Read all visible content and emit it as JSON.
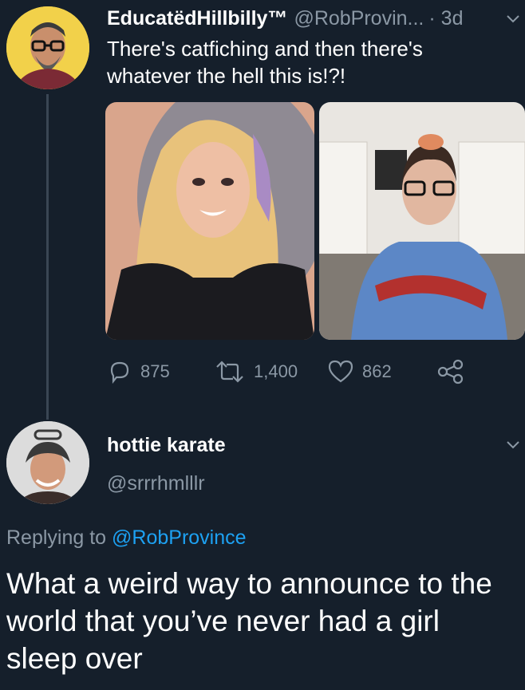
{
  "tweet1": {
    "display_name": "EducatëdHillbilly™",
    "handle": "@RobProvin...",
    "time": "· 3d",
    "text_line1": "There's catfiching and then there's",
    "text_line2": "whatever the hell this is!?!",
    "actions": {
      "replies": "875",
      "retweets": "1,400",
      "likes": "862"
    }
  },
  "reply": {
    "display_name": "hottie karate",
    "handle": "@srrrhmlllr",
    "replying_prefix": "Replying to ",
    "replying_to": "@RobProvince",
    "text": "What a weird way to announce to the world that you’ve never had a girl sleep over"
  },
  "colors": {
    "background": "#151f2b",
    "muted": "#8b98a5",
    "link": "#1da1f2"
  },
  "icons": [
    "reply-icon",
    "retweet-icon",
    "like-icon",
    "share-icon",
    "chevron-down-icon"
  ]
}
